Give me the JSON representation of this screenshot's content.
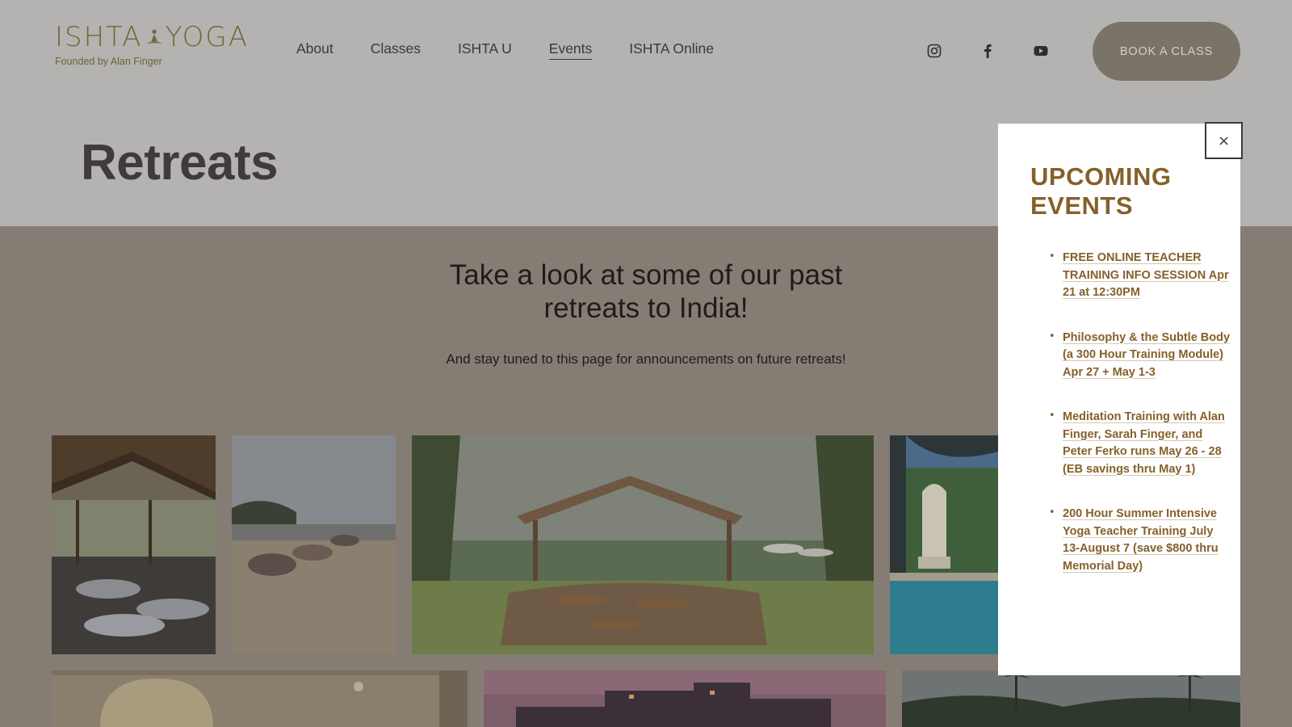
{
  "brand": {
    "logo_text": "ISHTA YOGA",
    "tagline": "Founded by Alan Finger",
    "logo_color": "#756735"
  },
  "nav": {
    "items": [
      {
        "label": "About"
      },
      {
        "label": "Classes"
      },
      {
        "label": "ISHTA U"
      },
      {
        "label": "Events",
        "active": true
      },
      {
        "label": "ISHTA Online"
      }
    ]
  },
  "social": [
    {
      "icon": "instagram-icon"
    },
    {
      "icon": "facebook-icon"
    },
    {
      "icon": "youtube-icon"
    }
  ],
  "book_button": {
    "label": "BOOK A CLASS"
  },
  "page": {
    "title": "Retreats",
    "headline": "Take a look at some of our past retreats to India!",
    "subline": "And stay tuned to this page for announcements on future retreats!"
  },
  "gallery": {
    "photos": [
      {
        "subject": "yoga class lying on mats under thatched pavilion"
      },
      {
        "subject": "group sitting on sandy beach"
      },
      {
        "subject": "thatched pergola with tables among palm trees"
      },
      {
        "subject": "palace pool with domed pavilion"
      },
      {
        "subject": "ornate white palace room"
      },
      {
        "subject": "fort at sunset"
      },
      {
        "subject": "palm trees at dusk"
      }
    ]
  },
  "popup": {
    "close_label": "×",
    "title": "UPCOMING EVENTS",
    "accent_color": "#86602a",
    "events": [
      {
        "label": "FREE ONLINE TEACHER TRAINING INFO SESSION Apr 21 at 12:30PM"
      },
      {
        "label": "Philosophy & the Subtle Body (a 300 Hour Training Module) Apr 27 + May 1-3"
      },
      {
        "label": "Meditation Training with Alan Finger, Sarah Finger,  and Peter Ferko runs May 26 - 28 (EB savings thru May 1)"
      },
      {
        "label": "200 Hour Summer Intensive Yoga Teacher Training July 13-August 7 (save $800 thru Memorial Day)"
      }
    ]
  }
}
